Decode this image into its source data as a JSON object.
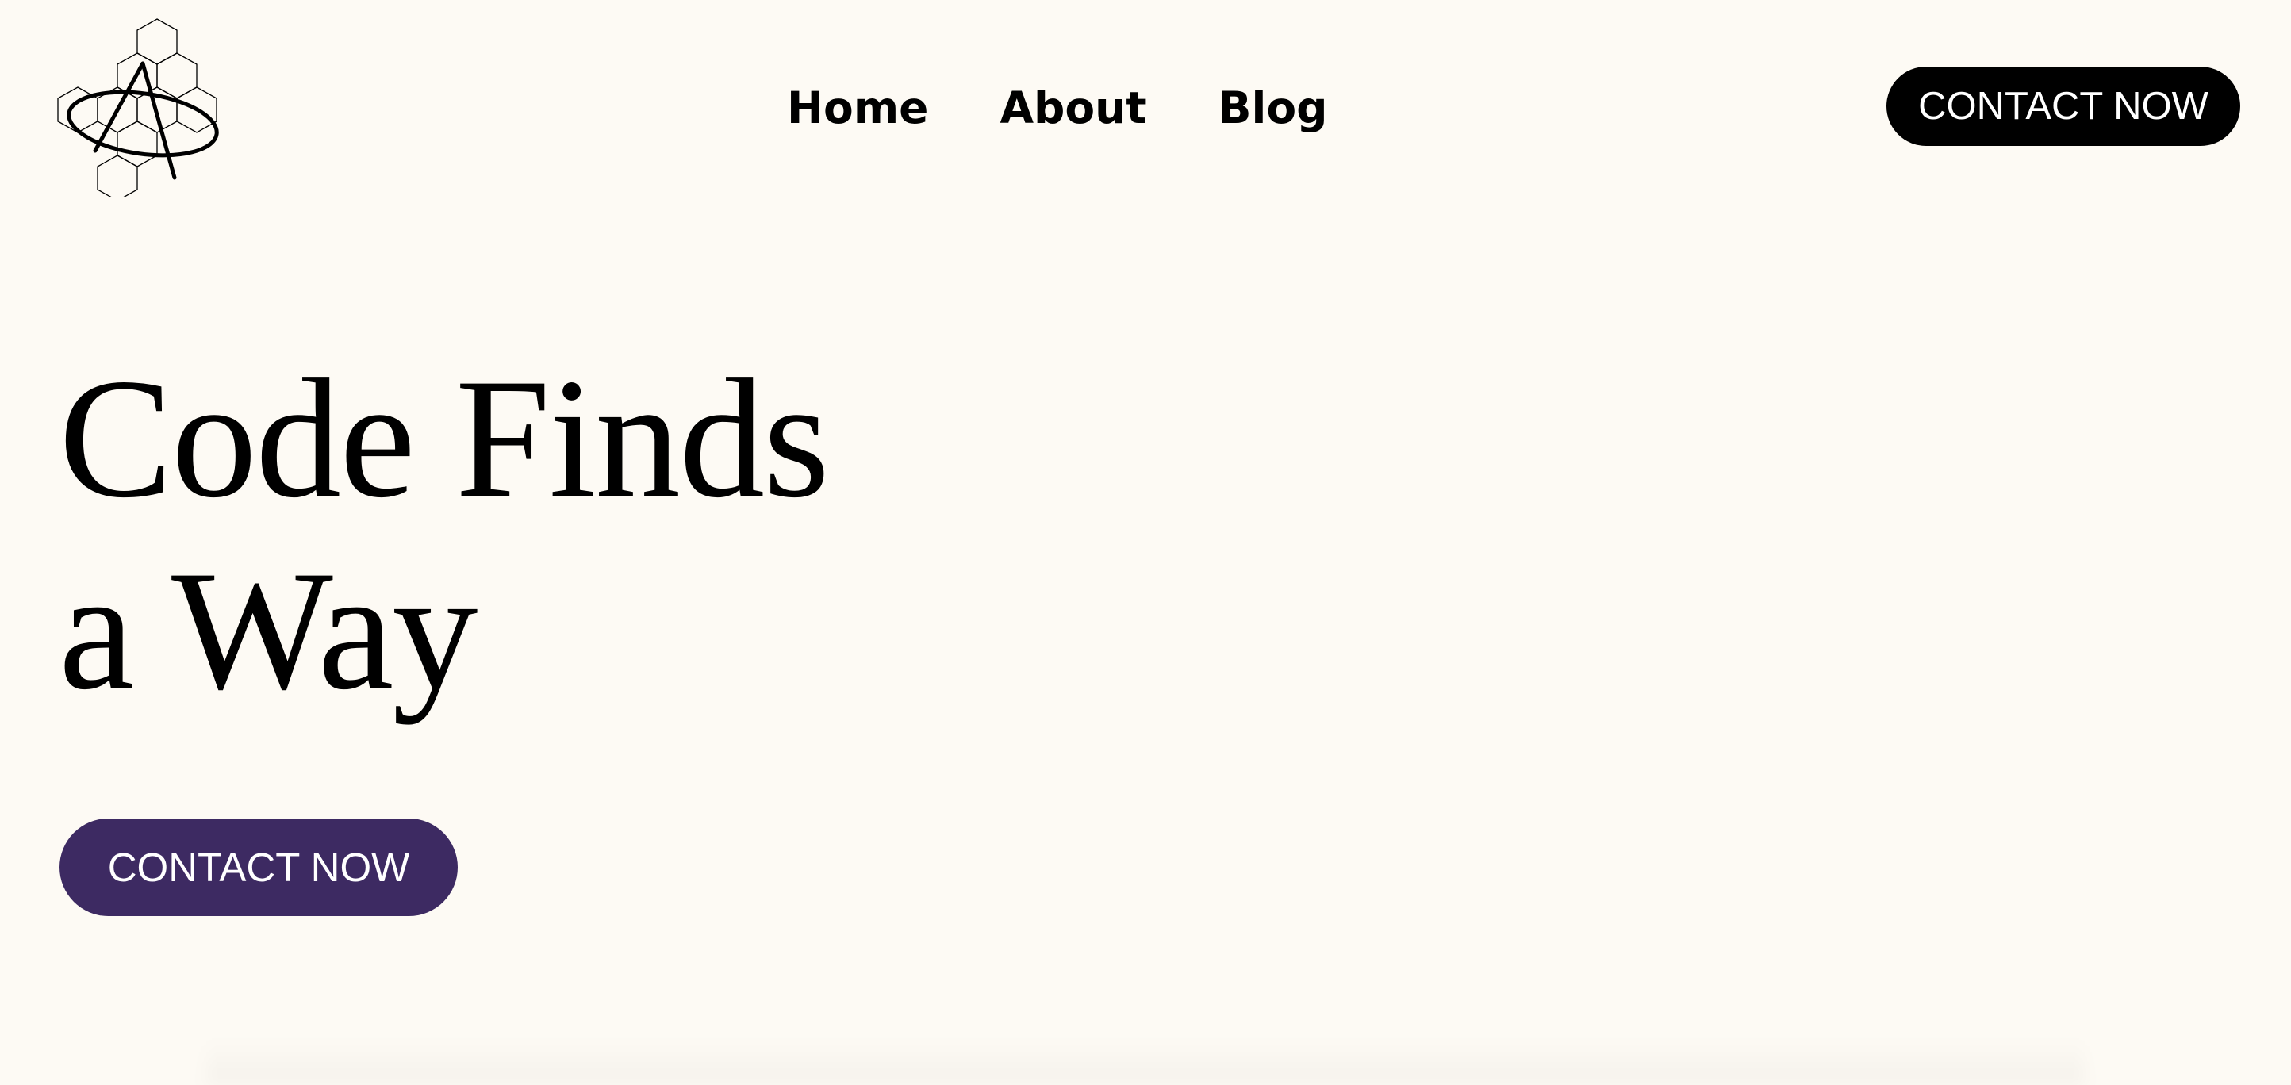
{
  "header": {
    "logo_icon": "hexagon-monogram-logo",
    "nav": {
      "home": "Home",
      "about": "About",
      "blog": "Blog"
    },
    "cta_label": "CONTACT NOW"
  },
  "hero": {
    "title_line1": "Code Finds",
    "title_line2": "a Way",
    "cta_label": "CONTACT NOW"
  },
  "colors": {
    "background": "#fdfaf4",
    "header_cta_bg": "#000000",
    "hero_cta_bg": "#3d2a62",
    "text": "#000000"
  }
}
